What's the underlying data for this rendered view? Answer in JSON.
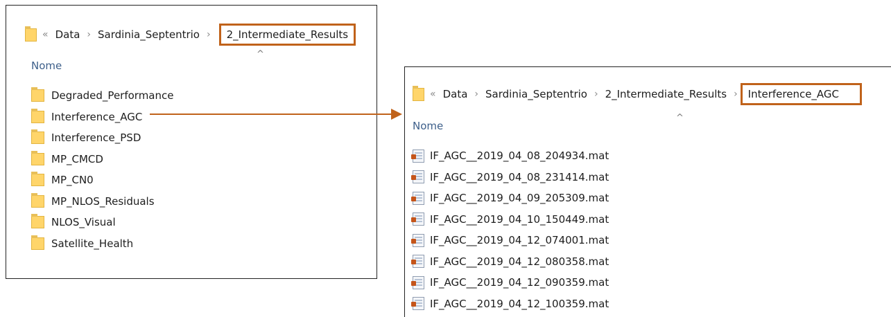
{
  "left_window": {
    "breadcrumb": {
      "back": "«",
      "items": [
        "Data",
        "Sardinia_Septentrio",
        "2_Intermediate_Results"
      ],
      "separator": "›"
    },
    "sort_indicator": "^",
    "column_header": "Nome",
    "folders": [
      "Degraded_Performance",
      "Interference_AGC",
      "Interference_PSD",
      "MP_CMCD",
      "MP_CN0",
      "MP_NLOS_Residuals",
      "NLOS_Visual",
      "Satellite_Health"
    ]
  },
  "right_window": {
    "breadcrumb": {
      "back": "«",
      "items": [
        "Data",
        "Sardinia_Septentrio",
        "2_Intermediate_Results",
        "Interference_AGC"
      ],
      "separator": "›"
    },
    "sort_indicator": "^",
    "column_header": "Nome",
    "files": [
      "IF_AGC__2019_04_08_204934.mat",
      "IF_AGC__2019_04_08_231414.mat",
      "IF_AGC__2019_04_09_205309.mat",
      "IF_AGC__2019_04_10_150449.mat",
      "IF_AGC__2019_04_12_074001.mat",
      "IF_AGC__2019_04_12_080358.mat",
      "IF_AGC__2019_04_12_090359.mat",
      "IF_AGC__2019_04_12_100359.mat"
    ]
  },
  "colors": {
    "highlight_box": "#c0621a",
    "connector_arrow": "#c0621a",
    "folder": "#ffd56a",
    "header_text": "#3d5f8a"
  },
  "icons": {
    "folder": "folder-icon",
    "file": "mat-file-icon"
  }
}
